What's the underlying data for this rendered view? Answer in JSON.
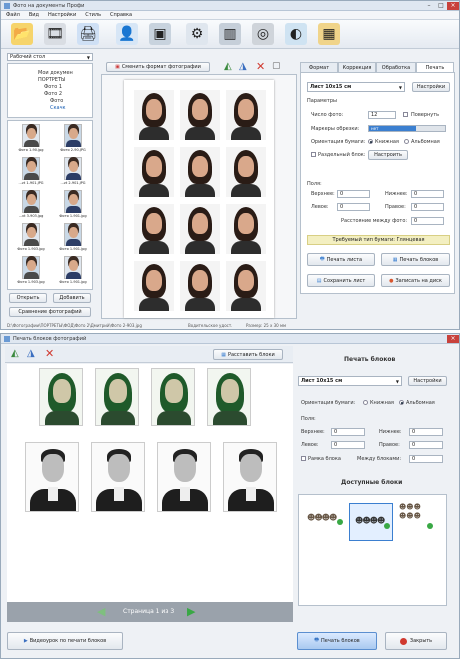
{
  "win1": {
    "title": "Фото на документы Профи",
    "menu": [
      "Файл",
      "Вид",
      "Настройки",
      "Стиль",
      "Справка"
    ],
    "toolbar_icons": [
      "open-folder-icon",
      "film-icon",
      "print-icon",
      "person-icon",
      "photo-tool-icon",
      "tools-icon",
      "crop-icon",
      "film-reel-icon",
      "globe-icon",
      "box-icon"
    ],
    "folder_panel": {
      "dropdown": "Рабочий стол",
      "tree": [
        "Мои докумен",
        "ПОРТРЕТЫ",
        "Фото 1",
        "Фото 2",
        "Фото",
        "Скачк"
      ],
      "thumbs": [
        "Фото 1-90.jpg",
        "Фото 2-90.JPG",
        "...vt 1-901.JPG",
        "...vt 2-901.JPG",
        "...vt 3-903.jpg",
        "Фото 1-901.jpg",
        "Фото 1-903.jpg",
        "Фото 1-901.jpg",
        "Фото 1-903.jpg",
        "Фото 1-901.jpg"
      ],
      "open_btn": "Открыть",
      "add_btn": "Добавить",
      "compare_btn": "Сравнение фотографий"
    },
    "center": {
      "change_format_btn": "Сменить формат фотографии"
    },
    "tabs": [
      "Формат",
      "Коррекция",
      "Обработка",
      "Печать"
    ],
    "right": {
      "sheet_select": "Лист 10x15 см",
      "settings_btn": "Настройки",
      "params_heading": "Параметры",
      "photos_count_label": "Число фото:",
      "photos_count_value": "12",
      "rotate_label": "Повернуть",
      "cut_marks_label": "Маркеры обрезки:",
      "cut_marks_value": "нет",
      "orientation_label": "Ориентация бумаги:",
      "orient_portrait": "Книжная",
      "orient_landscape": "Альбомная",
      "sep_block_label": "Раздельный блок:",
      "configure_btn": "Настроить",
      "fields_heading": "Поля:",
      "top_label": "Верхнее:",
      "bottom_label": "Нижнее:",
      "left_label": "Левое:",
      "right_label": "Правое:",
      "between_label": "Расстояние между фото:",
      "field_value": "0",
      "paper_notice": "Требуемый тип бумаги: Глянцевая",
      "print_sheet_btn": "Печать листа",
      "print_blocks_btn": "Печать блоков",
      "save_sheet_btn": "Сохранить лист",
      "order_btn": "Записать на диск"
    },
    "status": [
      "D:\\Фотографии\\ПОРТРЕТЫ\\ФОД\\Фото 2\\Дмитрий\\Фото 2-903.jpg",
      "Водительское удост.",
      "Размер: 25 x 30 мм"
    ]
  },
  "win2": {
    "title": "Печать блоков фотографий",
    "arrange_btn": "Расставить блоки",
    "page_label": "Страница 1 из 3",
    "print_blocks_heading": "Печать блоков",
    "sheet_select": "Лист 10x15 см",
    "settings_btn": "Настройки",
    "orientation_label": "Ориентация бумаги:",
    "orient_portrait": "Книжная",
    "orient_landscape": "Альбомная",
    "fields_heading": "Поля:",
    "top_label": "Верхнее:",
    "bottom_label": "Нижнее:",
    "left_label": "Левое:",
    "right_label": "Правое:",
    "frame_label": "Рамка блока",
    "between_label": "Между блоками:",
    "field_value": "0",
    "available_heading": "Доступные блоки",
    "video_btn": "Видеоурок по печати блоков",
    "print_btn": "Печать блоков",
    "close_btn": "Закрыть"
  },
  "colors": {
    "accent": "#3b7fd0",
    "green": "#39a845",
    "red": "#d0392f",
    "notice_bg": "#f3efc1",
    "progress": "#3b7fd0",
    "page_bar": "#9aa2ab"
  }
}
